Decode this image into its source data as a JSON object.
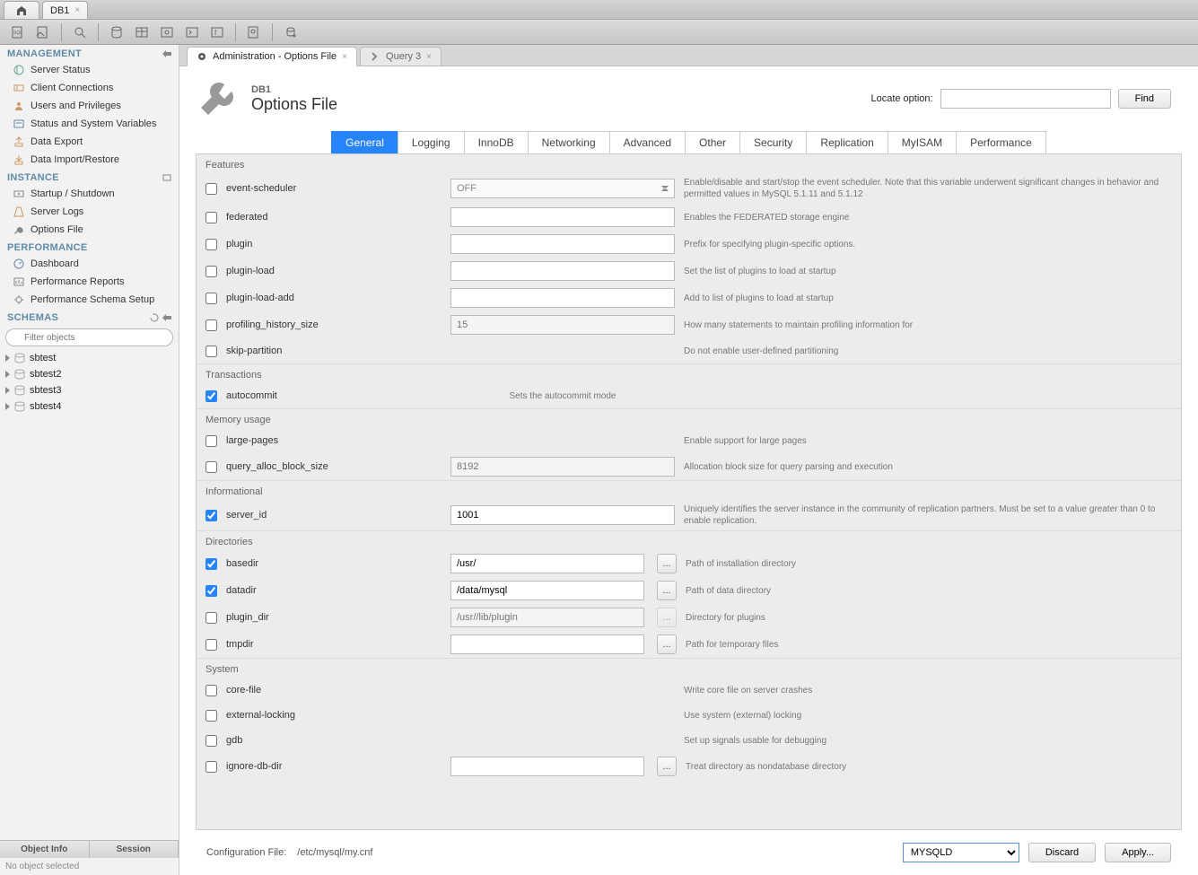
{
  "window": {
    "conn_tab": "DB1"
  },
  "sidebar": {
    "management_hdr": "MANAGEMENT",
    "management": [
      {
        "label": "Server Status",
        "name": "server-status"
      },
      {
        "label": "Client Connections",
        "name": "client-connections"
      },
      {
        "label": "Users and Privileges",
        "name": "users-privileges"
      },
      {
        "label": "Status and System Variables",
        "name": "status-sysvars"
      },
      {
        "label": "Data Export",
        "name": "data-export"
      },
      {
        "label": "Data Import/Restore",
        "name": "data-import"
      }
    ],
    "instance_hdr": "INSTANCE",
    "instance": [
      {
        "label": "Startup / Shutdown",
        "name": "startup-shutdown"
      },
      {
        "label": "Server Logs",
        "name": "server-logs"
      },
      {
        "label": "Options File",
        "name": "options-file"
      }
    ],
    "performance_hdr": "PERFORMANCE",
    "performance": [
      {
        "label": "Dashboard",
        "name": "dashboard"
      },
      {
        "label": "Performance Reports",
        "name": "perf-reports"
      },
      {
        "label": "Performance Schema Setup",
        "name": "perf-schema-setup"
      }
    ],
    "schemas_hdr": "SCHEMAS",
    "filter_placeholder": "Filter objects",
    "schemas": [
      "sbtest",
      "sbtest2",
      "sbtest3",
      "sbtest4"
    ],
    "bottom_tabs": [
      "Object Info",
      "Session"
    ],
    "no_obj": "No object selected"
  },
  "content_tabs": {
    "admin": "Administration - Options File",
    "query": "Query 3"
  },
  "page": {
    "breadcrumb": "DB1",
    "title": "Options File",
    "locate_label": "Locate option:",
    "find_label": "Find"
  },
  "option_tabs": [
    "General",
    "Logging",
    "InnoDB",
    "Networking",
    "Advanced",
    "Other",
    "Security",
    "Replication",
    "MyISAM",
    "Performance"
  ],
  "groups": [
    {
      "name": "Features",
      "rows": [
        {
          "key": "event-scheduler",
          "label": "event-scheduler",
          "checked": false,
          "ctrl": "select",
          "value": "OFF",
          "desc": "Enable/disable and start/stop the event scheduler. Note that this variable underwent significant changes in behavior and permitted values in MySQL 5.1.11 and 5.1.12"
        },
        {
          "key": "federated",
          "label": "federated",
          "checked": false,
          "ctrl": "text",
          "value": "",
          "desc": "Enables the FEDERATED storage engine"
        },
        {
          "key": "plugin",
          "label": "plugin",
          "checked": false,
          "ctrl": "text",
          "value": "",
          "desc": "Prefix for specifying plugin-specific options."
        },
        {
          "key": "plugin-load",
          "label": "plugin-load",
          "checked": false,
          "ctrl": "text",
          "value": "",
          "desc": "Set the list of plugins to load at startup"
        },
        {
          "key": "plugin-load-add",
          "label": "plugin-load-add",
          "checked": false,
          "ctrl": "text",
          "value": "",
          "desc": "Add to list of plugins to load at startup"
        },
        {
          "key": "profiling_history_size",
          "label": "profiling_history_size",
          "checked": false,
          "ctrl": "text-disabled",
          "value": "",
          "placeholder": "15",
          "desc": "How many statements to maintain profiling information for"
        },
        {
          "key": "skip-partition",
          "label": "skip-partition",
          "checked": false,
          "ctrl": "none",
          "desc": "Do not enable user-defined partitioning"
        }
      ]
    },
    {
      "name": "Transactions",
      "rows": [
        {
          "key": "autocommit",
          "label": "autocommit",
          "checked": true,
          "ctrl": "none-center",
          "desc": "Sets the autocommit mode"
        }
      ]
    },
    {
      "name": "Memory usage",
      "rows": [
        {
          "key": "large-pages",
          "label": "large-pages",
          "checked": false,
          "ctrl": "none",
          "desc": "Enable support for large pages"
        },
        {
          "key": "query_alloc_block_size",
          "label": "query_alloc_block_size",
          "checked": false,
          "ctrl": "text-disabled",
          "value": "",
          "placeholder": "8192",
          "desc": "Allocation block size for query parsing and execution"
        }
      ]
    },
    {
      "name": "Informational",
      "rows": [
        {
          "key": "server_id",
          "label": "server_id",
          "checked": true,
          "ctrl": "text",
          "value": "1001",
          "desc": "Uniquely identifies the server instance in the community of replication partners. Must be set to a value greater than 0 to enable replication."
        }
      ]
    },
    {
      "name": "Directories",
      "rows": [
        {
          "key": "basedir",
          "label": "basedir",
          "checked": true,
          "ctrl": "dir",
          "value": "/usr/",
          "desc": "Path of installation directory"
        },
        {
          "key": "datadir",
          "label": "datadir",
          "checked": true,
          "ctrl": "dir",
          "value": "/data/mysql",
          "desc": "Path of data directory"
        },
        {
          "key": "plugin_dir",
          "label": "plugin_dir",
          "checked": false,
          "ctrl": "dir-disabled",
          "value": "",
          "placeholder": "/usr//lib/plugin",
          "desc": "Directory for plugins"
        },
        {
          "key": "tmpdir",
          "label": "tmpdir",
          "checked": false,
          "ctrl": "dir",
          "value": "",
          "desc": "Path for temporary files"
        }
      ]
    },
    {
      "name": "System",
      "rows": [
        {
          "key": "core-file",
          "label": "core-file",
          "checked": false,
          "ctrl": "none",
          "desc": "Write core file on server crashes"
        },
        {
          "key": "external-locking",
          "label": "external-locking",
          "checked": false,
          "ctrl": "none",
          "desc": "Use system (external) locking"
        },
        {
          "key": "gdb",
          "label": "gdb",
          "checked": false,
          "ctrl": "none",
          "desc": "Set up signals usable for debugging"
        },
        {
          "key": "ignore-db-dir",
          "label": "ignore-db-dir",
          "checked": false,
          "ctrl": "dir",
          "value": "",
          "desc": "Treat directory as nondatabase directory"
        }
      ]
    }
  ],
  "footer": {
    "conf_label": "Configuration File:",
    "conf_path": "/etc/mysql/my.cnf",
    "section": "MYSQLD",
    "discard": "Discard",
    "apply": "Apply..."
  }
}
